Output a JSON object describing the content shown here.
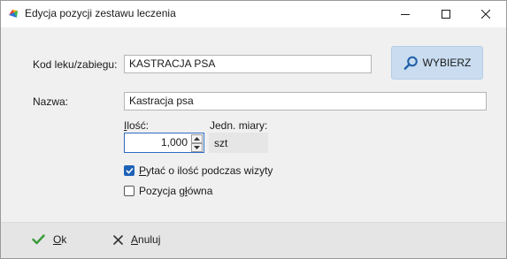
{
  "window": {
    "title": "Edycja pozycji zestawu leczenia"
  },
  "form": {
    "code_label": "Kod leku/zabiegu:",
    "code_value": "KASTRACJA PSA",
    "select_button": "WYBIERZ",
    "name_label": "Nazwa:",
    "name_value": "Kastracja psa",
    "qty_label_first": "I",
    "qty_label_rest": "lość:",
    "qty_value": "1,000",
    "unit_label": "Jedn. miary:",
    "unit_value": "szt",
    "ask_qty_first": "P",
    "ask_qty_rest": "ytać o ilość podczas wizyty",
    "ask_qty_checked": true,
    "main_pos_first": "Pozycja g",
    "main_pos_underlined": "ł",
    "main_pos_rest": "ówna",
    "main_pos_checked": false
  },
  "footer": {
    "ok_first": "O",
    "ok_rest": "k",
    "cancel_first": "A",
    "cancel_rest": "nuluj"
  },
  "colors": {
    "accent": "#1e62b8",
    "select_bg": "#c9dcf0",
    "ok_check": "#3a9a3a"
  },
  "icons": {
    "app": "app-icon",
    "select": "search-icon",
    "ok": "check-icon",
    "cancel": "close-icon"
  }
}
